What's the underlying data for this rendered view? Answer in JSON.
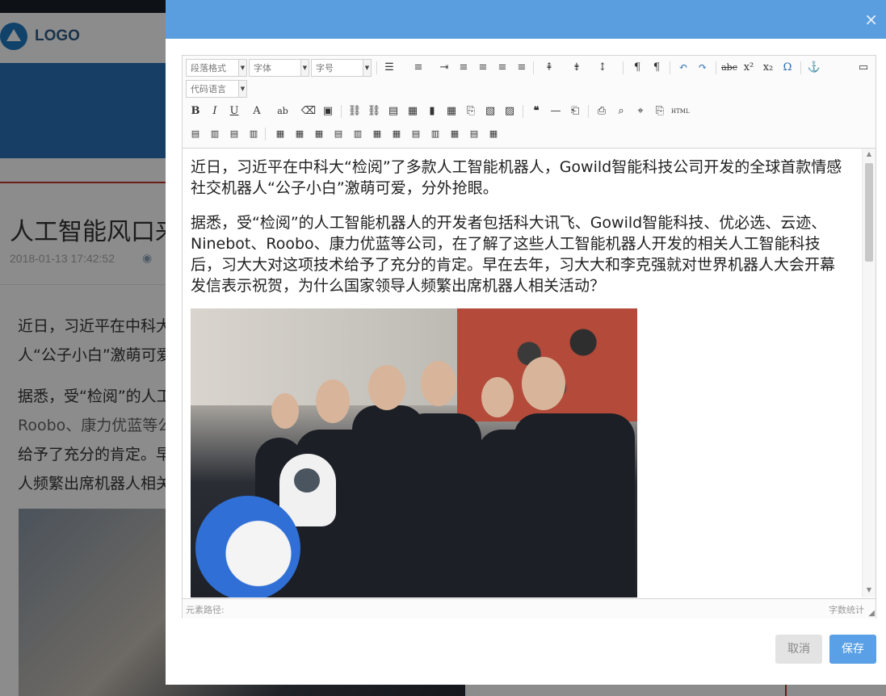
{
  "background": {
    "logo_text": "LOGO",
    "article_title": "人工智能风口来",
    "article_date": "2018-01-13 17:42:52",
    "paragraphs": [
      "近日，习近平在中科大",
      "人“公子小白”激萌可爱",
      "据悉，受“检阅”的人工",
      "Roobo、康力优蓝等公",
      "给予了充分的肯定。早",
      "人频繁出席机器人相关"
    ]
  },
  "dialog": {
    "close_label": "×",
    "toolbar": {
      "paragraph_format": "段落格式",
      "font_family": "字体",
      "font_size": "字号",
      "code_language": "代码语言"
    },
    "content": {
      "paragraph_1": "近日，习近平在中科大“检阅”了多款人工智能机器人，Gowild智能科技公司开发的全球首款情感社交机器人“公子小白”激萌可爱，分外抢眼。",
      "paragraph_2": "据悉，受“检阅”的人工智能机器人的开发者包括科大讯飞、Gowild智能科技、优必选、云迹、Ninebot、Roobo、康力优蓝等公司，在了解了这些人工智能机器人开发的相关人工智能科技后，习大大对这项技术给予了充分的肯定。早在去年，习大大和李克强就对世界机器人大会开幕发信表示祝贺，为什么国家领导人频繁出席机器人相关活动？"
    },
    "statusbar": {
      "element_path": "元素路径:",
      "word_count": "字数统计"
    },
    "buttons": {
      "cancel": "取消",
      "save": "保存"
    }
  },
  "colors": {
    "header_blue": "#5a9ee0",
    "save_blue": "#5aa0e6",
    "accent_red": "#c0392b"
  }
}
